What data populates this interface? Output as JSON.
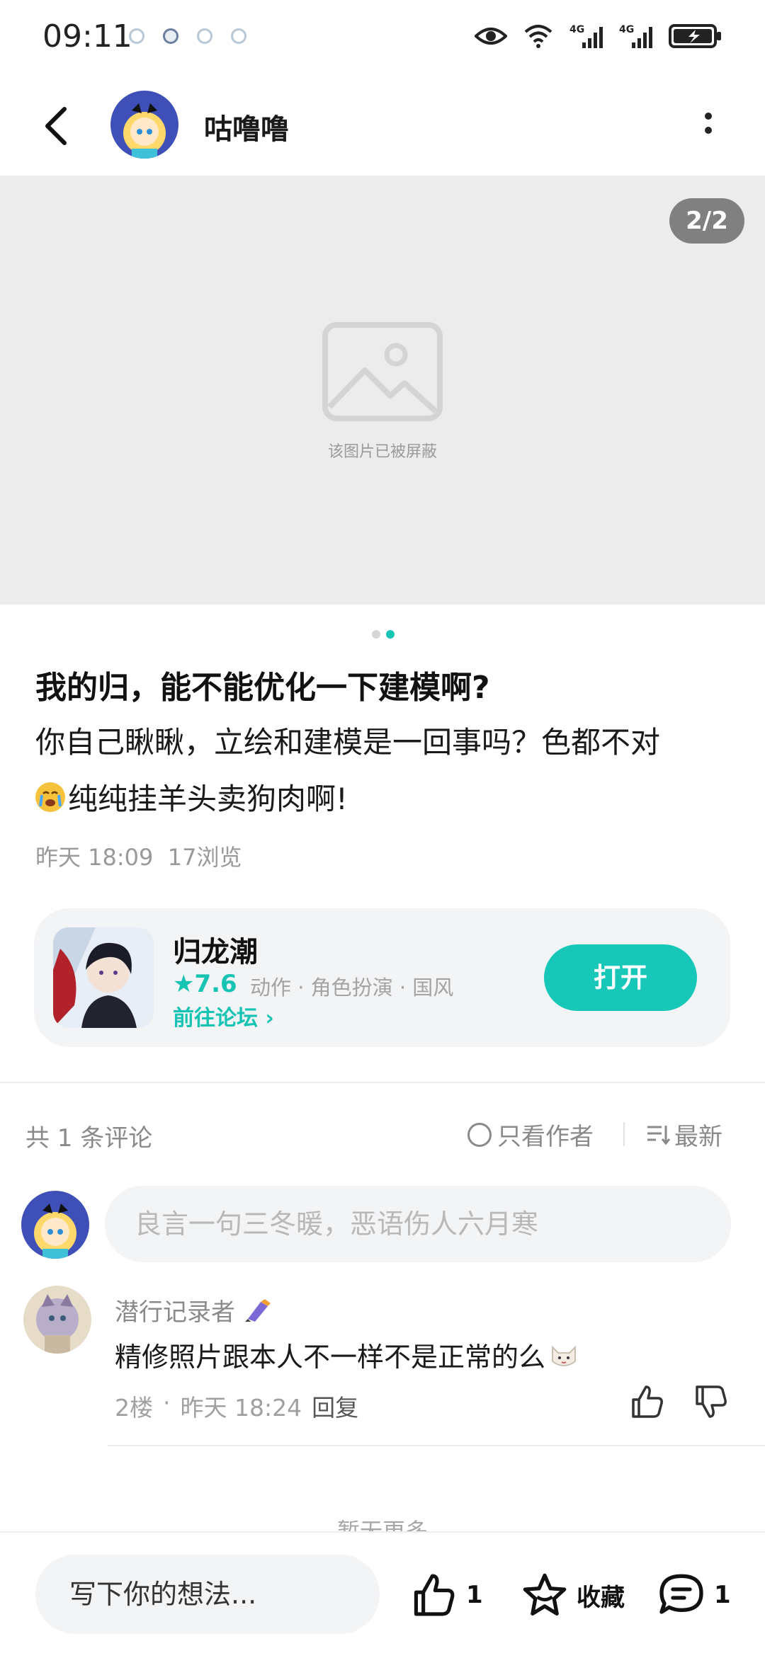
{
  "status_bar": {
    "time": "09:11",
    "icons": [
      "eye-icon",
      "wifi-icon",
      "signal-4g-icon",
      "signal-4g-icon",
      "battery-charging-icon"
    ]
  },
  "header": {
    "username": "咕噜噜",
    "back_icon": "back-arrow-icon",
    "more_icon": "more-vertical-icon"
  },
  "image": {
    "counter": "2/2",
    "placeholder_text": "该图片已被屏蔽",
    "page_dots": {
      "total": 2,
      "active": 2
    }
  },
  "post": {
    "title": "我的归，能不能优化一下建模啊?",
    "body_line1": "你自己瞅瞅，立绘和建模是一回事吗？色都不对",
    "body_line2": "纯纯挂羊头卖狗肉啊!",
    "time": "昨天 18:09",
    "views": "17浏览"
  },
  "game_card": {
    "name": "归龙潮",
    "rating": "7.6",
    "tags": "动作 · 角色扮演 · 国风",
    "forum_link": "前往论坛",
    "open_button": "打开"
  },
  "comments": {
    "count_label": "共 1 条评论",
    "author_only": "只看作者",
    "sort": "最新",
    "input_placeholder": "良言一句三冬暖，恶语伤人六月寒",
    "items": [
      {
        "user": "潜行记录者",
        "text": "精修照片跟本人不一样不是正常的么",
        "floor": "2楼",
        "time": "昨天 18:24",
        "reply": "回复"
      }
    ],
    "no_more": "暂无更多"
  },
  "bottom_bar": {
    "input_text": "写下你的想法...",
    "likes": "1",
    "favorite": "收藏",
    "comments": "1"
  },
  "colors": {
    "accent": "#17c3b2",
    "muted": "#8a8a8a",
    "card_bg": "#f3f4f6"
  }
}
